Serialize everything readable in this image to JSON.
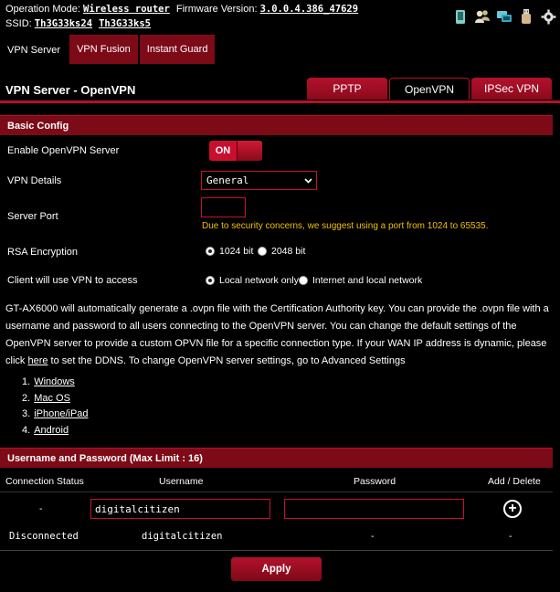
{
  "topbar": {
    "operation_mode_label": "Operation Mode:",
    "operation_mode_value": "Wireless router",
    "firmware_label": "Firmware Version:",
    "firmware_value": "3.0.0.4.386_47629",
    "ssid_label": "SSID:",
    "ssid_1": "Th3G33ks24",
    "ssid_2": "Th3G33ks5",
    "icons": [
      "mobile-icon",
      "users-icon",
      "network-icon",
      "usb-icon",
      "gear-icon"
    ]
  },
  "tabs": [
    {
      "label": "VPN Server",
      "active": true
    },
    {
      "label": "VPN Fusion",
      "active": false
    },
    {
      "label": "Instant Guard",
      "active": false
    }
  ],
  "page_title": "VPN Server - OpenVPN",
  "subtabs": [
    {
      "label": "PPTP",
      "active": false
    },
    {
      "label": "OpenVPN",
      "active": true
    },
    {
      "label": "IPSec VPN",
      "active": false
    }
  ],
  "basic_config": {
    "header": "Basic Config",
    "enable_label": "Enable OpenVPN Server",
    "toggle_value": "ON",
    "vpn_details_label": "VPN Details",
    "vpn_details_value": "General",
    "server_port_label": "Server Port",
    "server_port_value": "",
    "port_hint": "Due to security concerns, we suggest using a port from 1024 to 65535.",
    "rsa_label": "RSA Encryption",
    "rsa_options": [
      "1024 bit",
      "2048 bit"
    ],
    "rsa_selected": "1024 bit",
    "access_label": "Client will use VPN to access",
    "access_options": [
      "Local network only",
      "Internet and local network"
    ],
    "access_selected": "Local network only"
  },
  "description": {
    "text_before": "GT-AX6000 will automatically generate a .ovpn file with the Certification Authority key. You can provide the .ovpn file with a username and password to all users connecting to the OpenVPN server. You can change the default settings of the OpenVPN server to provide a custom OPVN file for a specific connection type. If your WAN IP address is dynamic, please click ",
    "link": "here",
    "text_after": " to set the DDNS. To change OpenVPN server settings, go to Advanced Settings"
  },
  "os_list": [
    {
      "num": "1.",
      "label": "Windows"
    },
    {
      "num": "2.",
      "label": "Mac OS"
    },
    {
      "num": "3.",
      "label": "iPhone/iPad"
    },
    {
      "num": "4.",
      "label": "Android"
    }
  ],
  "users": {
    "header": "Username and Password (Max Limit : 16)",
    "columns": [
      "Connection Status",
      "Username",
      "Password",
      "Add / Delete"
    ],
    "new_row": {
      "status": "-",
      "username": "digitalcitizen",
      "password": ""
    },
    "rows": [
      {
        "status": "Disconnected",
        "username": "digitalcitizen",
        "password": "-",
        "action": "-"
      }
    ]
  },
  "apply_label": "Apply",
  "colors": {
    "accent": "#b3112c",
    "dark_red": "#7d0a17",
    "hint": "#f0c000"
  }
}
